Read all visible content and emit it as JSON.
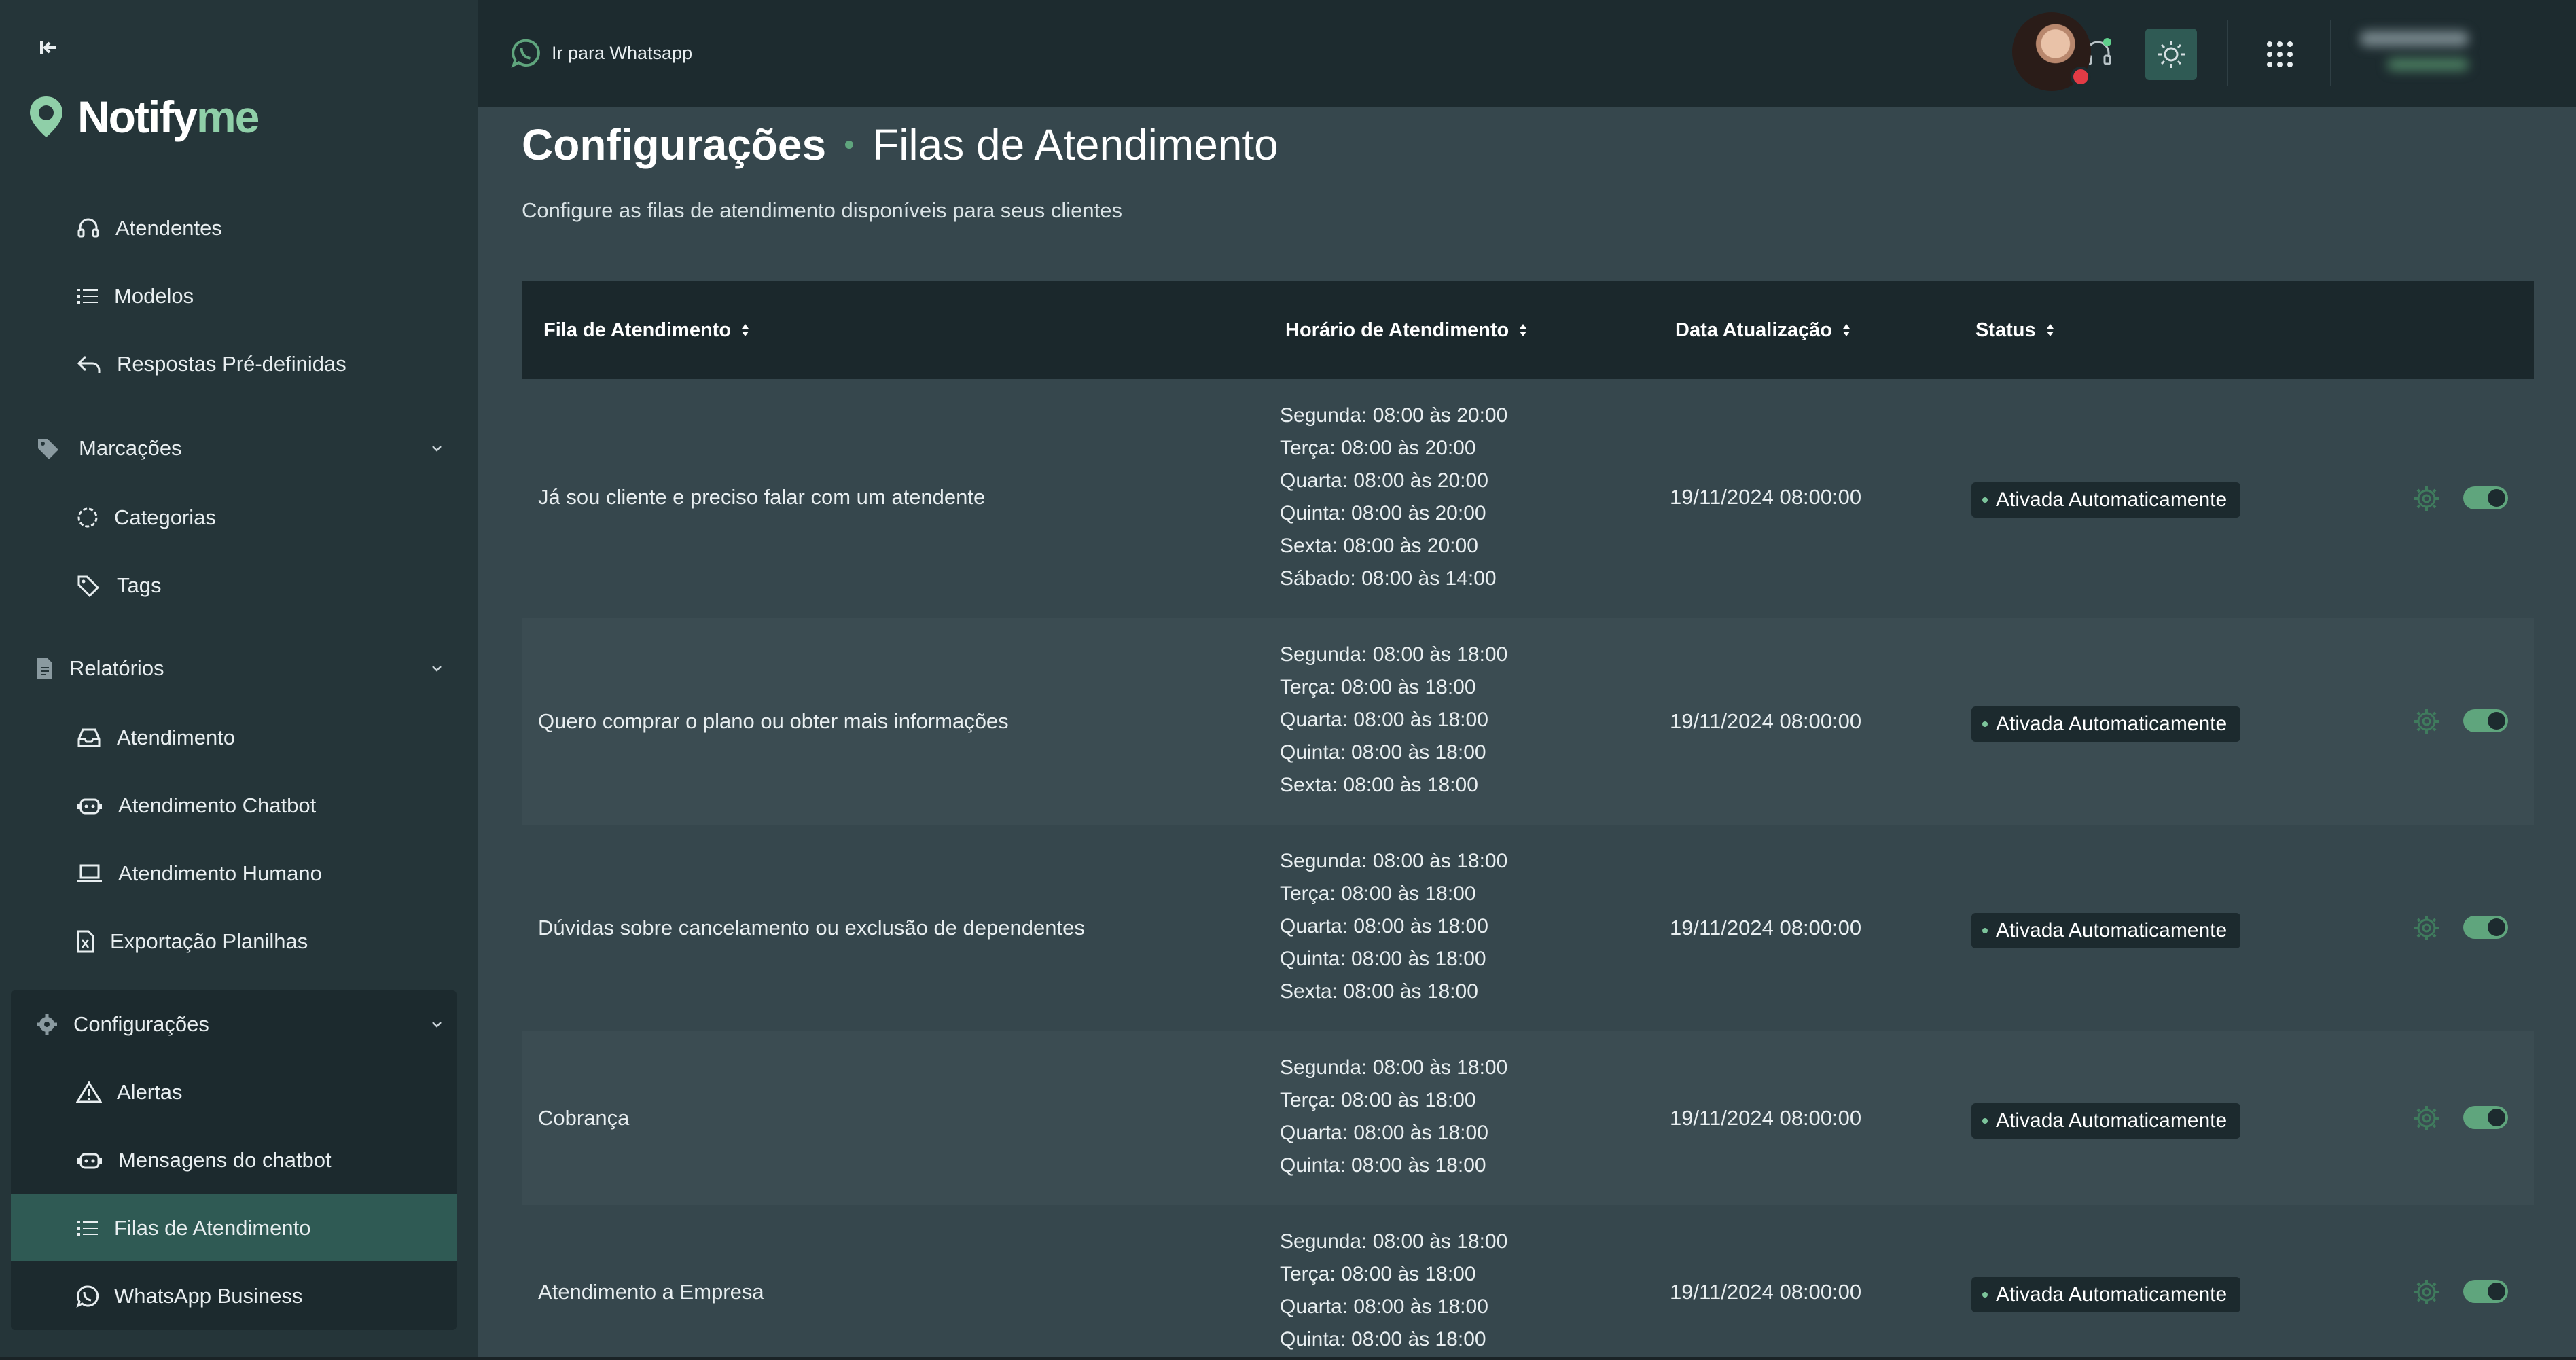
{
  "app": {
    "logo_main": "Notify",
    "logo_accent": "me"
  },
  "topbar": {
    "whatsapp_link": "Ir para Whatsapp",
    "colors": {
      "bar": "#1d2b2f",
      "accent": "#5fa57d"
    }
  },
  "sidebar": {
    "items_group1": [
      {
        "label": "Atendentes",
        "icon": "headset-icon"
      },
      {
        "label": "Modelos",
        "icon": "list-icon"
      },
      {
        "label": "Respostas Pré-definidas",
        "icon": "reply-icon"
      }
    ],
    "marcacoes": {
      "label": "Marcações",
      "items": [
        {
          "label": "Categorias",
          "icon": "circle-icon"
        },
        {
          "label": "Tags",
          "icon": "tag-icon"
        }
      ]
    },
    "relatorios": {
      "label": "Relatórios",
      "items": [
        {
          "label": "Atendimento",
          "icon": "inbox-icon"
        },
        {
          "label": "Atendimento Chatbot",
          "icon": "robot-icon"
        },
        {
          "label": "Atendimento Humano",
          "icon": "laptop-icon"
        },
        {
          "label": "Exportação Planilhas",
          "icon": "excel-icon"
        }
      ]
    },
    "configuracoes": {
      "label": "Configurações",
      "items": [
        {
          "label": "Alertas",
          "icon": "warning-icon"
        },
        {
          "label": "Mensagens do chatbot",
          "icon": "robot-icon"
        },
        {
          "label": "Filas de Atendimento",
          "icon": "list-icon",
          "active": true
        },
        {
          "label": "WhatsApp Business",
          "icon": "whatsapp-icon"
        }
      ]
    }
  },
  "page": {
    "title": "Configurações",
    "section": "Filas de Atendimento",
    "subtitle": "Configure as filas de atendimento disponíveis para seus clientes"
  },
  "table": {
    "columns": [
      "Fila de Atendimento",
      "Horário de Atendimento",
      "Data Atualização",
      "Status"
    ],
    "rows": [
      {
        "fila": "Já sou cliente e preciso falar com um atendente",
        "horario": [
          "Segunda: 08:00 às 20:00",
          "Terça: 08:00 às 20:00",
          "Quarta: 08:00 às 20:00",
          "Quinta: 08:00 às 20:00",
          "Sexta: 08:00 às 20:00",
          "Sábado: 08:00 às 14:00"
        ],
        "data": "19/11/2024 08:00:00",
        "status": "Ativada Automaticamente",
        "enabled": true
      },
      {
        "fila": "Quero comprar o plano ou obter mais informações",
        "horario": [
          "Segunda: 08:00 às 18:00",
          "Terça: 08:00 às 18:00",
          "Quarta: 08:00 às 18:00",
          "Quinta: 08:00 às 18:00",
          "Sexta: 08:00 às 18:00"
        ],
        "data": "19/11/2024 08:00:00",
        "status": "Ativada Automaticamente",
        "enabled": true
      },
      {
        "fila": "Dúvidas sobre cancelamento ou exclusão de dependentes",
        "horario": [
          "Segunda: 08:00 às 18:00",
          "Terça: 08:00 às 18:00",
          "Quarta: 08:00 às 18:00",
          "Quinta: 08:00 às 18:00",
          "Sexta: 08:00 às 18:00"
        ],
        "data": "19/11/2024 08:00:00",
        "status": "Ativada Automaticamente",
        "enabled": true
      },
      {
        "fila": "Cobrança",
        "horario": [
          "Segunda: 08:00 às 18:00",
          "Terça: 08:00 às 18:00",
          "Quarta: 08:00 às 18:00",
          "Quinta: 08:00 às 18:00"
        ],
        "data": "19/11/2024 08:00:00",
        "status": "Ativada Automaticamente",
        "enabled": true
      },
      {
        "fila": "Atendimento a Empresa",
        "horario": [
          "Segunda: 08:00 às 18:00",
          "Terça: 08:00 às 18:00",
          "Quarta: 08:00 às 18:00",
          "Quinta: 08:00 às 18:00"
        ],
        "data": "19/11/2024 08:00:00",
        "status": "Ativada Automaticamente",
        "enabled": true
      }
    ]
  }
}
